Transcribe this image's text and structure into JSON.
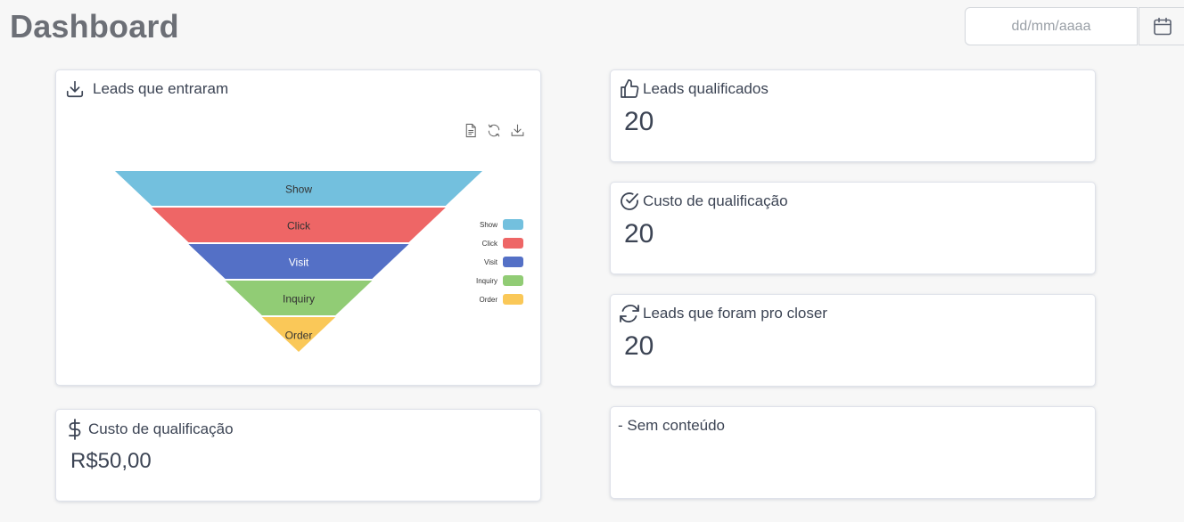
{
  "page": {
    "title": "Dashboard"
  },
  "date_filter": {
    "placeholder": "dd/mm/aaaa",
    "calendar_icon": "calendar-icon"
  },
  "cards": {
    "leads_entraram": {
      "title": "Leads que entraram",
      "icon": "download-icon"
    },
    "custo_bottom": {
      "title": "Custo de qualificação",
      "value": "R$50,00",
      "icon": "dollar-icon"
    },
    "leads_qualificados": {
      "title": "Leads qualificados",
      "value": "20",
      "icon": "thumbs-up-icon"
    },
    "custo_qualificacao": {
      "title": "Custo de qualificação",
      "value": "20",
      "icon": "check-circle-icon"
    },
    "leads_closer": {
      "title": "Leads que foram pro closer",
      "value": "20",
      "icon": "refresh-icon"
    },
    "sem_conteudo": {
      "title": "- Sem conteúdo"
    }
  },
  "chart_toolbox": [
    "data-view-icon",
    "restore-icon",
    "save-image-icon"
  ],
  "chart_data": {
    "type": "funnel",
    "categories": [
      "Show",
      "Click",
      "Visit",
      "Inquiry",
      "Order"
    ],
    "values": [
      100,
      80,
      60,
      40,
      20
    ],
    "colors": [
      "#73c0de",
      "#ee6666",
      "#5470c6",
      "#91cc75",
      "#fac858"
    ],
    "label_colors": [
      "#333333",
      "#333333",
      "#ffffff",
      "#333333",
      "#333333"
    ],
    "legend_position": "right"
  }
}
